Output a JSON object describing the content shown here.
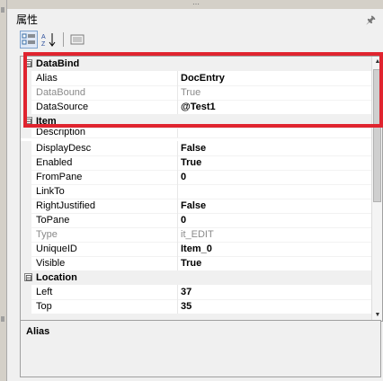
{
  "panel": {
    "title": "属性",
    "pin_icon": "pin-icon"
  },
  "toolbar": {
    "buttons": [
      "categorized-icon",
      "alphabetical-icon",
      "property-pages-icon"
    ]
  },
  "grid": {
    "categories": [
      {
        "name": "DataBind",
        "toggle": "⊟",
        "rows": [
          {
            "name": "Alias",
            "value": "DocEntry",
            "disabled": false
          },
          {
            "name": "DataBound",
            "value": "True",
            "disabled": true
          },
          {
            "name": "DataSource",
            "value": "@Test1",
            "disabled": false
          }
        ]
      },
      {
        "name": "Item",
        "toggle": "⊟",
        "rows": [
          {
            "name": "Description",
            "value": "",
            "disabled": false
          },
          {
            "name": "DisplayDesc",
            "value": "False",
            "disabled": false
          },
          {
            "name": "Enabled",
            "value": "True",
            "disabled": false
          },
          {
            "name": "FromPane",
            "value": "0",
            "disabled": false
          },
          {
            "name": "LinkTo",
            "value": "",
            "disabled": false
          },
          {
            "name": "RightJustified",
            "value": "False",
            "disabled": false
          },
          {
            "name": "ToPane",
            "value": "0",
            "disabled": false
          },
          {
            "name": "Type",
            "value": "it_EDIT",
            "disabled": true
          },
          {
            "name": "UniqueID",
            "value": "Item_0",
            "disabled": false
          },
          {
            "name": "Visible",
            "value": "True",
            "disabled": false
          }
        ]
      },
      {
        "name": "Location",
        "toggle": "⊟",
        "rows": [
          {
            "name": "Left",
            "value": "37",
            "disabled": false
          },
          {
            "name": "Top",
            "value": "35",
            "disabled": false
          }
        ]
      }
    ]
  },
  "description": {
    "title": "Alias"
  },
  "colors": {
    "highlight_border": "#e0242f",
    "category_bg": "#f0f0f0"
  }
}
